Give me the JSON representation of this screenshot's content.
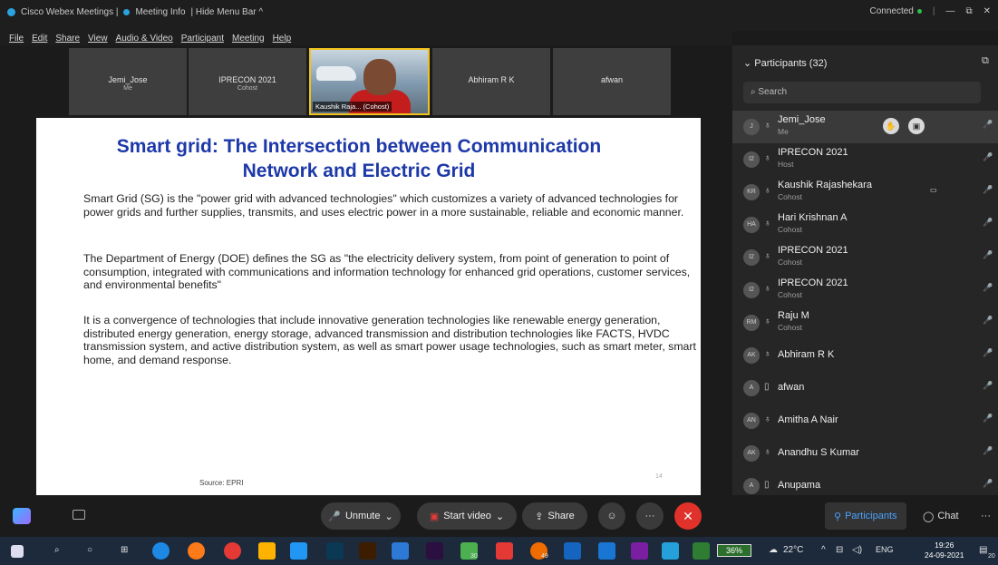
{
  "titlebar": {
    "app": "Cisco Webex Meetings |",
    "meeting_info": "Meeting Info",
    "hide_menu": "| Hide Menu Bar ^",
    "status": "Connected",
    "minimize": "—",
    "restore": "⧉",
    "close": "✕"
  },
  "menu": [
    "File",
    "Edit",
    "Share",
    "View",
    "Audio & Video",
    "Participant",
    "Meeting",
    "Help"
  ],
  "video_strip": [
    {
      "name": "Jemi_Jose",
      "sub": "Me"
    },
    {
      "name": "IPRECON 2021",
      "sub": "Cohost"
    },
    {
      "name": "Kaushik Raja... (Cohost)",
      "sub": "",
      "active": true
    },
    {
      "name": "Abhiram R K",
      "sub": ""
    },
    {
      "name": "afwan",
      "sub": ""
    }
  ],
  "slide": {
    "title_line1": "Smart grid: The Intersection between Communication",
    "title_line2": "Network and Electric Grid",
    "p1": "Smart Grid (SG) is the \"power grid with advanced technologies\" which customizes a variety of advanced technologies for power grids and further supplies, transmits, and uses electric power in a more sustainable, reliable and economic manner.",
    "p2": "The Department of Energy (DOE) defines the SG as \"the electricity delivery system, from point of generation to point of consumption, integrated with communications and information technology for enhanced grid operations, customer services, and environmental benefits\"",
    "p3": "It is a convergence of technologies that include innovative generation technologies like renewable energy generation, distributed energy generation, energy storage, advanced transmission and distribution technologies like FACTS, HVDC transmission system, and active distribution system, as well as smart power usage technologies, such as smart meter, smart home, and demand response.",
    "source": "Source: EPRI",
    "page": "14"
  },
  "panel": {
    "title": "Participants (32)",
    "search_placeholder": "Search"
  },
  "participants": [
    {
      "initials": "J",
      "name": "Jemi_Jose",
      "role": "Me",
      "mic": "muted"
    },
    {
      "initials": "I2",
      "name": "IPRECON 2021",
      "role": "Host",
      "mic": "muted"
    },
    {
      "initials": "KR",
      "name": "Kaushik Rajashekara",
      "role": "Cohost",
      "mic": "active"
    },
    {
      "initials": "HA",
      "name": "Hari Krishnan A",
      "role": "Cohost",
      "mic": "muted"
    },
    {
      "initials": "I2",
      "name": "IPRECON 2021",
      "role": "Cohost",
      "mic": "muted"
    },
    {
      "initials": "I2",
      "name": "IPRECON 2021",
      "role": "Cohost",
      "mic": "muted"
    },
    {
      "initials": "RM",
      "name": "Raju M",
      "role": "Cohost",
      "mic": "muted"
    },
    {
      "initials": "AK",
      "name": "Abhiram R K",
      "role": "",
      "mic": "muted"
    },
    {
      "initials": "A",
      "name": "afwan",
      "role": "",
      "mic": "muted"
    },
    {
      "initials": "AN",
      "name": "Amitha A Nair",
      "role": "",
      "mic": "muted"
    },
    {
      "initials": "AK",
      "name": "Anandhu S Kumar",
      "role": "",
      "mic": "muted"
    },
    {
      "initials": "A",
      "name": "Anupama",
      "role": "",
      "mic": "muted"
    }
  ],
  "controls": {
    "unmute": "Unmute",
    "start_video": "Start video",
    "share": "Share",
    "participants": "Participants",
    "chat": "Chat",
    "more": "···",
    "end": "✕"
  },
  "taskbar": {
    "battery": "36%",
    "temp": "22°C",
    "lang": "ENG",
    "time": "19:26",
    "date": "24-09-2021",
    "badge_a": "30",
    "badge_b": "49",
    "badge_notif": "20"
  },
  "colors": {
    "title_blue": "#1d38a8",
    "accent": "#4aa3ff",
    "end_red": "#e0312b",
    "active_border": "#f1c21b"
  }
}
